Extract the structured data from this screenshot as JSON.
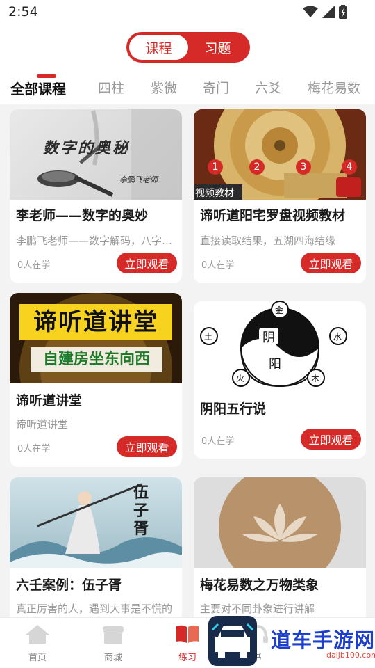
{
  "status_bar": {
    "time": "2:54"
  },
  "toggle": {
    "course_label": "课程",
    "exercise_label": "习题"
  },
  "tabs": [
    "全部课程",
    "四柱",
    "紫微",
    "奇门",
    "六爻",
    "梅花易数"
  ],
  "cards": [
    {
      "title": "李老师——数字的奥妙",
      "desc": "李鹏飞老师——数字解码，八字命理的专业讲解",
      "count": "0人在学",
      "button": "立即观看",
      "img_text": "数字的奥秘",
      "img_sub": "李鹏飞老师"
    },
    {
      "title": "谛听道阳宅罗盘视频教材",
      "desc": "直接读取结果，五湖四海结缘",
      "count": "0人在学",
      "button": "立即观看",
      "img_caption": "视频教材",
      "img_numbers": [
        "1",
        "2",
        "3",
        "4"
      ]
    },
    {
      "title": "谛听道讲堂",
      "desc": "谛听道讲堂",
      "count": "0人在学",
      "button": "立即观看",
      "img_text": "谛听道讲堂",
      "img_sub": "自建房坐东向西"
    },
    {
      "title": "阴阳五行说",
      "desc": "",
      "count": "0人在学",
      "button": "立即观看",
      "img_yin": "阴",
      "img_yang": "阳",
      "img_elements": [
        "金",
        "水",
        "木",
        "火",
        "土"
      ]
    },
    {
      "title": "六壬案例：伍子胥",
      "desc": "真正厉害的人，遇到大事是不慌的",
      "count": "",
      "button": "",
      "img_text": "伍子胥"
    },
    {
      "title": "梅花易数之万物类象",
      "desc": "主要对不同卦象进行讲解",
      "count": "",
      "button": ""
    }
  ],
  "bottom_nav": [
    {
      "label": "首页",
      "icon": "home-icon"
    },
    {
      "label": "商城",
      "icon": "shop-icon"
    },
    {
      "label": "练习",
      "icon": "book-icon"
    },
    {
      "label": "书",
      "icon": "headphone-icon"
    }
  ],
  "watermark": {
    "text": "道车手游网",
    "url": "daijb100.com"
  },
  "colors": {
    "accent": "#d52a27",
    "background": "#f3f3f3"
  }
}
